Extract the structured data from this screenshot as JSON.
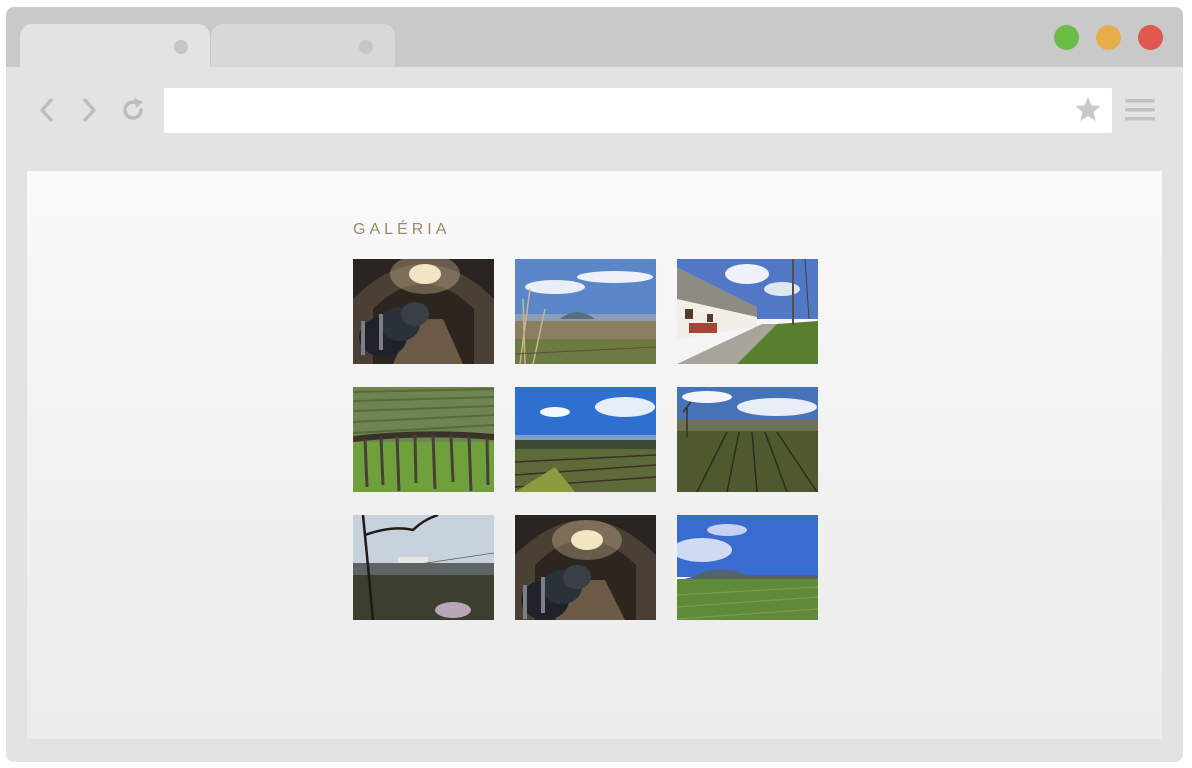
{
  "browser": {
    "tabs": [
      {
        "state": "active"
      },
      {
        "state": "inactive"
      }
    ],
    "window_controls": [
      "green",
      "yellow",
      "red"
    ],
    "colors": {
      "green": "#6bbd45",
      "yellow": "#e7ad4c",
      "red": "#e0584f"
    },
    "icons": [
      "back-arrow-icon",
      "forward-arrow-icon",
      "reload-icon",
      "star-icon",
      "menu-icon"
    ],
    "address": {
      "value": ""
    }
  },
  "page": {
    "title": "GALÉRIA",
    "title_color": "#9c8a66"
  },
  "gallery": {
    "images": [
      {
        "name": "wine-cellar-photo"
      },
      {
        "name": "landscape-vineyard-hill-photo"
      },
      {
        "name": "village-street-cottages-photo"
      },
      {
        "name": "vineyard-rows-closeup-photo"
      },
      {
        "name": "vineyard-blue-sky-photo"
      },
      {
        "name": "vineyard-village-view-photo"
      },
      {
        "name": "tree-branch-village-view-photo"
      },
      {
        "name": "wine-cellar-photo-2"
      },
      {
        "name": "green-field-hill-photo"
      }
    ]
  }
}
